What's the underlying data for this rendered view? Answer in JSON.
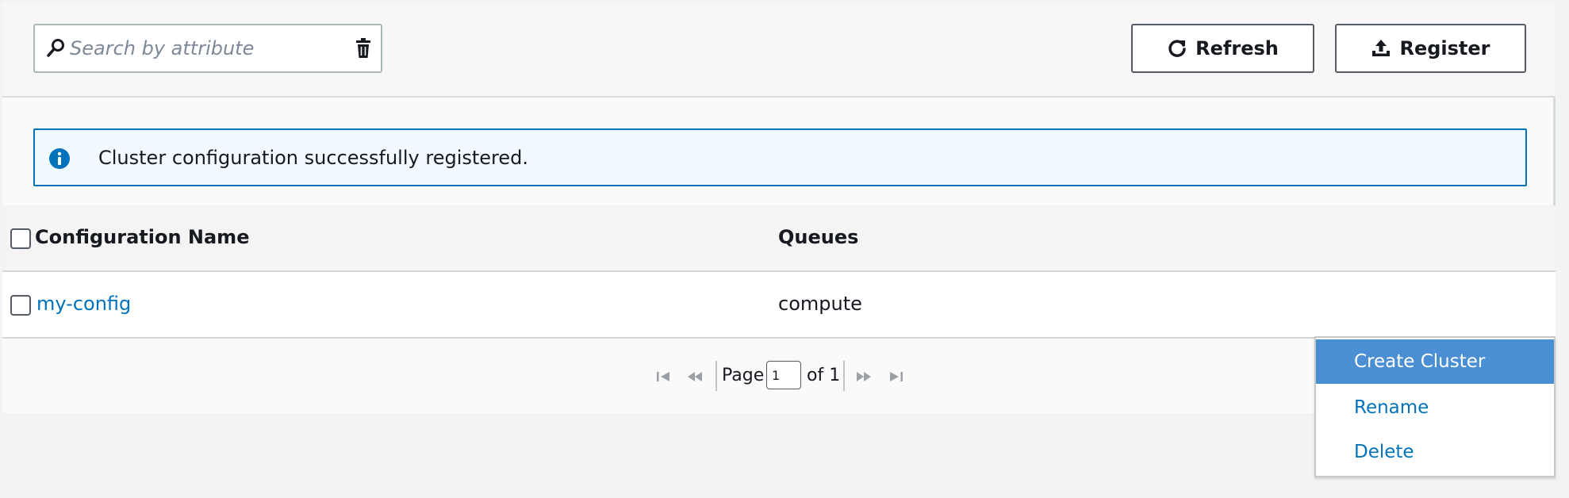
{
  "toolbar": {
    "search_placeholder": "Search by attribute",
    "search_icon": "search-icon",
    "clear_icon": "trash-icon",
    "refresh_label": "Refresh",
    "refresh_icon": "refresh-icon",
    "register_label": "Register",
    "register_icon": "upload-icon"
  },
  "alert": {
    "icon": "info-icon",
    "message": "Cluster configuration successfully registered.",
    "accent": "#0073bb",
    "background": "#f1faff"
  },
  "table": {
    "columns": [
      "Configuration Name",
      "Queues"
    ],
    "rows": [
      {
        "name": "my-config",
        "queues": "compute"
      }
    ]
  },
  "pagination": {
    "page_label": "Page",
    "current_page": "1",
    "of_label": "of 1"
  },
  "context_menu": {
    "items": [
      "Create Cluster",
      "Rename",
      "Delete"
    ],
    "active_index": 0
  },
  "colors": {
    "link": "#0073bb",
    "menu_active": "#4a8fd3"
  }
}
